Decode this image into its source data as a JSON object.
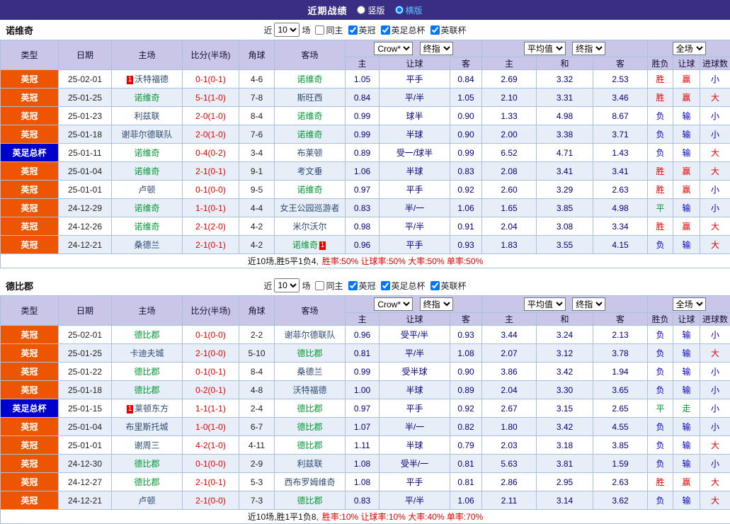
{
  "colors": {
    "topbar_bg": "#3a2d84",
    "table_header_bg": "#cac6e8",
    "league_badge_bg": "#ee5500",
    "cup_badge_bg": "#0000cc",
    "win_red": "#e60000",
    "loss_blue": "#0000d0",
    "draw_green": "#009933",
    "focus_team_green": "#009933",
    "odds_navy": "#000080",
    "row_alt_bg": "#e8eef8",
    "grid_border": "#a8c2dc"
  },
  "topbar": {
    "title": "近期战绩",
    "vertical_label": "竖版",
    "horizontal_label": "横版"
  },
  "controls": {
    "near_label": "近",
    "rounds_value": "10",
    "matches_label": "场",
    "same_home_label": "同主",
    "league_filter_label": "英冠",
    "facup_filter_label": "英足总杯",
    "eflcup_filter_label": "英联杯"
  },
  "header": {
    "dd_company": "Crow*",
    "dd_final_ah": "终指",
    "dd_average": "平均值",
    "dd_final_eu": "终指",
    "dd_fulltime": "全场",
    "col_type": "类型",
    "col_date": "日期",
    "col_home": "主场",
    "col_score": "比分(半场)",
    "col_corner": "角球",
    "col_away": "客场",
    "col_ah_home": "主",
    "col_ah_line": "让球",
    "col_ah_away": "客",
    "col_eu_home": "主",
    "col_eu_draw": "和",
    "col_eu_away": "客",
    "col_result": "胜负",
    "col_ah_result": "让球",
    "col_goals": "进球数"
  },
  "tables": [
    {
      "team": "诺维奇",
      "summary_main": "近10场,胜5平1负4,",
      "summary_stats": "胜率:50% 让球率:50% 大率:50% 单率:50%",
      "rows": [
        {
          "type": "英冠",
          "date": "25-02-01",
          "home": "沃特福德",
          "home_card": "1",
          "score": "0-1(0-1)",
          "corner": "4-6",
          "away": "诺维奇",
          "away_focus": true,
          "ah": [
            "1.05",
            "平手",
            "0.84"
          ],
          "eu": [
            "2.69",
            "3.32",
            "2.53"
          ],
          "res": [
            "胜",
            "赢",
            "小"
          ]
        },
        {
          "type": "英冠",
          "date": "25-01-25",
          "home": "诺维奇",
          "home_focus": true,
          "score": "5-1(1-0)",
          "corner": "7-8",
          "away": "斯旺西",
          "ah": [
            "0.84",
            "平/半",
            "1.05"
          ],
          "eu": [
            "2.10",
            "3.31",
            "3.46"
          ],
          "res": [
            "胜",
            "赢",
            "大"
          ]
        },
        {
          "type": "英冠",
          "date": "25-01-23",
          "home": "利兹联",
          "score": "2-0(1-0)",
          "corner": "8-4",
          "away": "诺维奇",
          "away_focus": true,
          "ah": [
            "0.99",
            "球半",
            "0.90"
          ],
          "eu": [
            "1.33",
            "4.98",
            "8.67"
          ],
          "res": [
            "负",
            "输",
            "小"
          ]
        },
        {
          "type": "英冠",
          "date": "25-01-18",
          "home": "谢菲尔德联队",
          "score": "2-0(1-0)",
          "corner": "7-6",
          "away": "诺维奇",
          "away_focus": true,
          "ah": [
            "0.99",
            "半球",
            "0.90"
          ],
          "eu": [
            "2.00",
            "3.38",
            "3.71"
          ],
          "res": [
            "负",
            "输",
            "小"
          ]
        },
        {
          "type": "英足总杯",
          "date": "25-01-11",
          "home": "诺维奇",
          "home_focus": true,
          "score": "0-4(0-2)",
          "corner": "3-4",
          "away": "布莱顿",
          "ah": [
            "0.89",
            "受一/球半",
            "0.99"
          ],
          "eu": [
            "6.52",
            "4.71",
            "1.43"
          ],
          "res": [
            "负",
            "输",
            "大"
          ]
        },
        {
          "type": "英冠",
          "date": "25-01-04",
          "home": "诺维奇",
          "home_focus": true,
          "score": "2-1(0-1)",
          "corner": "9-1",
          "away": "考文垂",
          "ah": [
            "1.06",
            "半球",
            "0.83"
          ],
          "eu": [
            "2.08",
            "3.41",
            "3.41"
          ],
          "res": [
            "胜",
            "赢",
            "大"
          ]
        },
        {
          "type": "英冠",
          "date": "25-01-01",
          "home": "卢顿",
          "score": "0-1(0-0)",
          "corner": "9-5",
          "away": "诺维奇",
          "away_focus": true,
          "ah": [
            "0.97",
            "平手",
            "0.92"
          ],
          "eu": [
            "2.60",
            "3.29",
            "2.63"
          ],
          "res": [
            "胜",
            "赢",
            "小"
          ]
        },
        {
          "type": "英冠",
          "date": "24-12-29",
          "home": "诺维奇",
          "home_focus": true,
          "score": "1-1(0-1)",
          "corner": "4-4",
          "away": "女王公园巡游者",
          "ah": [
            "0.83",
            "半/一",
            "1.06"
          ],
          "eu": [
            "1.65",
            "3.85",
            "4.98"
          ],
          "res": [
            "平",
            "输",
            "小"
          ]
        },
        {
          "type": "英冠",
          "date": "24-12-26",
          "home": "诺维奇",
          "home_focus": true,
          "score": "2-1(2-0)",
          "corner": "4-2",
          "away": "米尔沃尔",
          "ah": [
            "0.98",
            "平/半",
            "0.91"
          ],
          "eu": [
            "2.04",
            "3.08",
            "3.34"
          ],
          "res": [
            "胜",
            "赢",
            "大"
          ]
        },
        {
          "type": "英冠",
          "date": "24-12-21",
          "home": "桑德兰",
          "score": "2-1(0-1)",
          "corner": "4-2",
          "away": "诺维奇",
          "away_focus": true,
          "away_card": "1",
          "away_card_after": true,
          "ah": [
            "0.96",
            "平手",
            "0.93"
          ],
          "eu": [
            "1.83",
            "3.55",
            "4.15"
          ],
          "res": [
            "负",
            "输",
            "大"
          ]
        }
      ]
    },
    {
      "team": "德比郡",
      "summary_main": "近10场,胜1平1负8,",
      "summary_stats": "胜率:10% 让球率:10% 大率:40% 单率:70%",
      "rows": [
        {
          "type": "英冠",
          "date": "25-02-01",
          "home": "德比郡",
          "home_focus": true,
          "score": "0-1(0-0)",
          "corner": "2-2",
          "away": "谢菲尔德联队",
          "ah": [
            "0.96",
            "受平/半",
            "0.93"
          ],
          "eu": [
            "3.44",
            "3.24",
            "2.13"
          ],
          "res": [
            "负",
            "输",
            "小"
          ]
        },
        {
          "type": "英冠",
          "date": "25-01-25",
          "home": "卡迪夫城",
          "score": "2-1(0-0)",
          "corner": "5-10",
          "away": "德比郡",
          "away_focus": true,
          "ah": [
            "0.81",
            "平/半",
            "1.08"
          ],
          "eu": [
            "2.07",
            "3.12",
            "3.78"
          ],
          "res": [
            "负",
            "输",
            "大"
          ]
        },
        {
          "type": "英冠",
          "date": "25-01-22",
          "home": "德比郡",
          "home_focus": true,
          "score": "0-1(0-1)",
          "corner": "8-4",
          "away": "桑德兰",
          "ah": [
            "0.99",
            "受半球",
            "0.90"
          ],
          "eu": [
            "3.86",
            "3.42",
            "1.94"
          ],
          "res": [
            "负",
            "输",
            "小"
          ]
        },
        {
          "type": "英冠",
          "date": "25-01-18",
          "home": "德比郡",
          "home_focus": true,
          "score": "0-2(0-1)",
          "corner": "4-8",
          "away": "沃特福德",
          "ah": [
            "1.00",
            "半球",
            "0.89"
          ],
          "eu": [
            "2.04",
            "3.30",
            "3.65"
          ],
          "res": [
            "负",
            "输",
            "小"
          ]
        },
        {
          "type": "英足总杯",
          "date": "25-01-15",
          "home": "莱顿东方",
          "home_card": "1",
          "score": "1-1(1-1)",
          "corner": "2-4",
          "away": "德比郡",
          "away_focus": true,
          "ah": [
            "0.97",
            "平手",
            "0.92"
          ],
          "eu": [
            "2.67",
            "3.15",
            "2.65"
          ],
          "res": [
            "平",
            "走",
            "小"
          ]
        },
        {
          "type": "英冠",
          "date": "25-01-04",
          "home": "布里斯托城",
          "score": "1-0(1-0)",
          "corner": "6-7",
          "away": "德比郡",
          "away_focus": true,
          "ah": [
            "1.07",
            "半/一",
            "0.82"
          ],
          "eu": [
            "1.80",
            "3.42",
            "4.55"
          ],
          "res": [
            "负",
            "输",
            "小"
          ]
        },
        {
          "type": "英冠",
          "date": "25-01-01",
          "home": "谢周三",
          "score": "4-2(1-0)",
          "corner": "4-11",
          "away": "德比郡",
          "away_focus": true,
          "ah": [
            "1.11",
            "半球",
            "0.79"
          ],
          "eu": [
            "2.03",
            "3.18",
            "3.85"
          ],
          "res": [
            "负",
            "输",
            "大"
          ]
        },
        {
          "type": "英冠",
          "date": "24-12-30",
          "home": "德比郡",
          "home_focus": true,
          "score": "0-1(0-0)",
          "corner": "2-9",
          "away": "利兹联",
          "ah": [
            "1.08",
            "受半/一",
            "0.81"
          ],
          "eu": [
            "5.63",
            "3.81",
            "1.59"
          ],
          "res": [
            "负",
            "输",
            "小"
          ]
        },
        {
          "type": "英冠",
          "date": "24-12-27",
          "home": "德比郡",
          "home_focus": true,
          "score": "2-1(0-1)",
          "corner": "5-3",
          "away": "西布罗姆维奇",
          "ah": [
            "1.08",
            "平手",
            "0.81"
          ],
          "eu": [
            "2.86",
            "2.95",
            "2.63"
          ],
          "res": [
            "胜",
            "赢",
            "大"
          ]
        },
        {
          "type": "英冠",
          "date": "24-12-21",
          "home": "卢顿",
          "score": "2-1(0-0)",
          "corner": "7-3",
          "away": "德比郡",
          "away_focus": true,
          "ah": [
            "0.83",
            "平/半",
            "1.06"
          ],
          "eu": [
            "2.11",
            "3.14",
            "3.62"
          ],
          "res": [
            "负",
            "输",
            "大"
          ]
        }
      ]
    }
  ]
}
